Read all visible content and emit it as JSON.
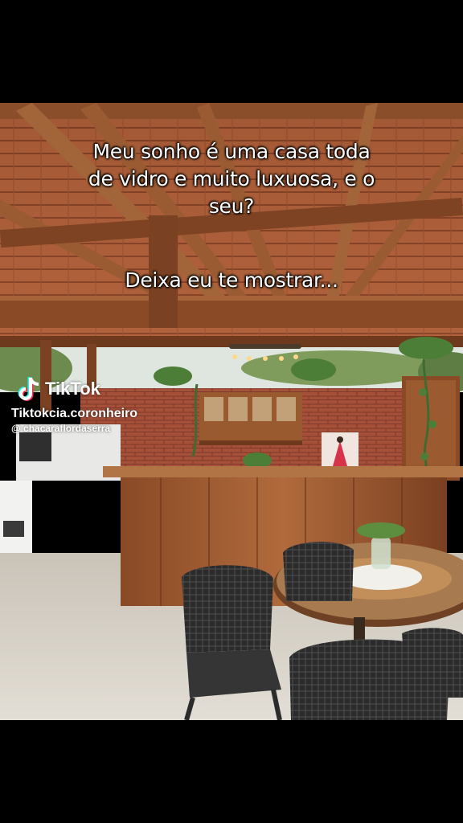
{
  "caption": {
    "lines_top": [
      "Meu sonho é uma casa toda",
      "de vidro e muito luxuosa, e o",
      "seu?"
    ],
    "line_bottom": "Deixa eu te mostrar..."
  },
  "watermark": {
    "brand": "TikTok",
    "username": "Tiktokcia.coronheiro",
    "handle": "@ chacaraflordaserra"
  },
  "colors": {
    "tiktok_cyan": "#25F4EE",
    "tiktok_red": "#FE2C55",
    "wood": "#8a4f2a",
    "brick": "#a24c33"
  }
}
